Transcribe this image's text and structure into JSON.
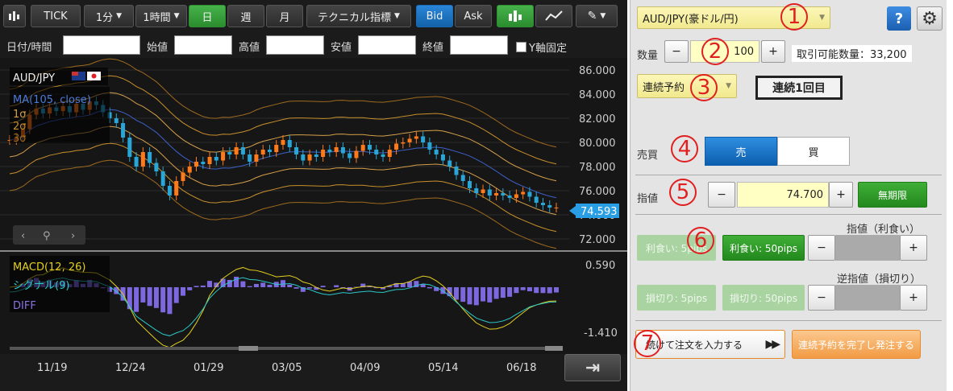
{
  "toolbar": {
    "tick": "TICK",
    "interval1": "1分",
    "interval2": "1時間",
    "day": "日",
    "week": "週",
    "month": "月",
    "technical": "テクニカル指標",
    "bid": "Bid",
    "ask": "Ask"
  },
  "ohlc": {
    "datetime": "日付/時間",
    "open": "始値",
    "high": "高値",
    "low": "安値",
    "close": "終値",
    "yfix": "Y軸固定"
  },
  "legend": {
    "pair": "AUD/JPY",
    "ma": "MA(105, close)",
    "s1": "1σ",
    "s2": "2σ",
    "s3": "3σ",
    "macd": "MACD(12, 26)",
    "signal": "シグナル(9)",
    "diff": "DIFF"
  },
  "chart_data": {
    "type": "candlestick",
    "pair": "AUD/JPY",
    "price_axis": {
      "ticks": [
        "86.000",
        "84.000",
        "82.000",
        "80.000",
        "78.000",
        "76.000",
        "74.000",
        "72.000"
      ],
      "ylim": [
        71.0,
        87.0
      ]
    },
    "current_price": "74.593",
    "x_ticks": [
      "11/19",
      "12/24",
      "01/29",
      "03/05",
      "04/09",
      "05/14",
      "06/18"
    ],
    "close_series": [
      80.2,
      80.4,
      81.1,
      82.3,
      82.8,
      82.4,
      82.9,
      82.6,
      83.0,
      82.5,
      83.2,
      82.7,
      83.4,
      83.1,
      82.5,
      82.0,
      81.6,
      80.4,
      78.8,
      78.0,
      79.2,
      78.3,
      77.6,
      76.4,
      75.6,
      76.8,
      77.5,
      78.0,
      78.4,
      78.2,
      78.8,
      78.5,
      79.2,
      79.0,
      79.6,
      79.0,
      78.4,
      79.0,
      79.4,
      79.2,
      79.8,
      80.2,
      79.6,
      79.0,
      78.5,
      79.0,
      78.8,
      79.4,
      79.2,
      79.6,
      79.1,
      78.7,
      79.3,
      79.8,
      79.4,
      79.0,
      78.8,
      79.4,
      79.9,
      80.0,
      80.3,
      80.5,
      80.0,
      79.4,
      79.0,
      78.5,
      78.0,
      77.3,
      76.8,
      76.2,
      75.8,
      76.1,
      75.6,
      75.8,
      75.6,
      75.4,
      75.7,
      75.9,
      75.5,
      75.0,
      74.8,
      74.6,
      74.6
    ],
    "macd_axis": {
      "max_label": "0.590",
      "min_label": "-1.410"
    }
  },
  "order": {
    "symbol": "AUD/JPY(豪ドル/円)",
    "help": "?",
    "qty_label": "数量",
    "qty_minus": "−",
    "qty_value": "100",
    "qty_plus": "+",
    "tradable": "取引可能数量：33,200",
    "order_type": "連続予約",
    "renzoku": "連続1回目",
    "side_label": "売買",
    "sell": "売",
    "buy": "買",
    "price_label": "指値",
    "price_minus": "−",
    "price_value": "74.700",
    "price_plus": "+",
    "unlimited": "無期限",
    "tp_header": "指値（利食い）",
    "tp_5": "利食い: 5pips",
    "tp_50": "利食い: 50pips",
    "sl_header": "逆指値（損切り）",
    "sl_5": "損切り: 5pips",
    "sl_50": "損切り: 50pips",
    "minus": "−",
    "plus": "+",
    "continue": "続けて注文を入力する",
    "finish": "連続予約を完了し発注する"
  },
  "markers": [
    "1",
    "2",
    "3",
    "4",
    "5",
    "6",
    "7"
  ]
}
